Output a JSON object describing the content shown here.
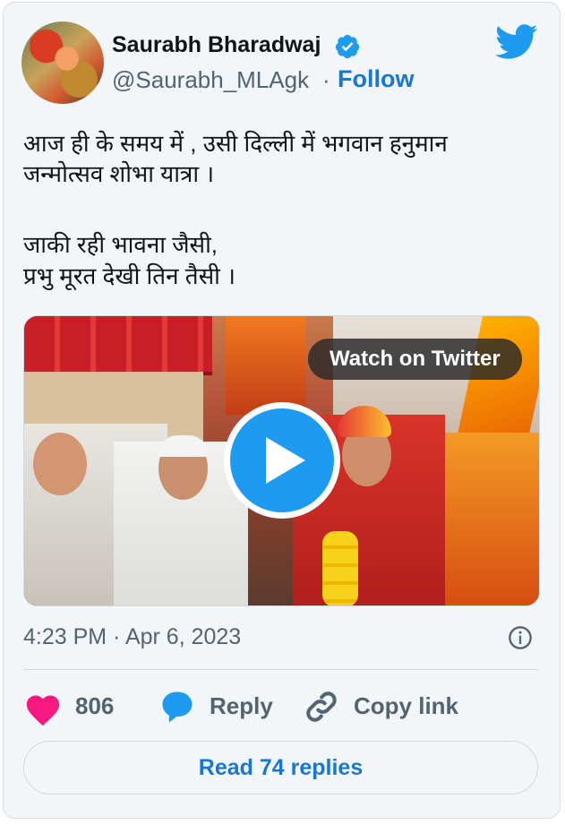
{
  "author": {
    "name": "Saurabh Bharadwaj",
    "handle": "@Saurabh_MLAgk",
    "separator": "·",
    "follow_label": "Follow"
  },
  "tweet": {
    "lines": [
      "आज ही के समय में , उसी दिल्ली में भगवान हनुमान",
      "जन्मोत्सव शोभा यात्रा ।",
      "जाकी रही भावना जैसी,",
      "प्रभु मूरत देखी तिन तैसी ।"
    ]
  },
  "media": {
    "watch_label": "Watch on Twitter"
  },
  "meta": {
    "timestamp": "4:23 PM · Apr 6, 2023"
  },
  "actions": {
    "likes": "806",
    "reply_label": "Reply",
    "copy_label": "Copy link"
  },
  "read_replies_label": "Read 74 replies",
  "colors": {
    "accent": "#1877d2",
    "twitter_blue": "#1d9bf0",
    "heart": "#f91880",
    "muted": "#536471"
  }
}
